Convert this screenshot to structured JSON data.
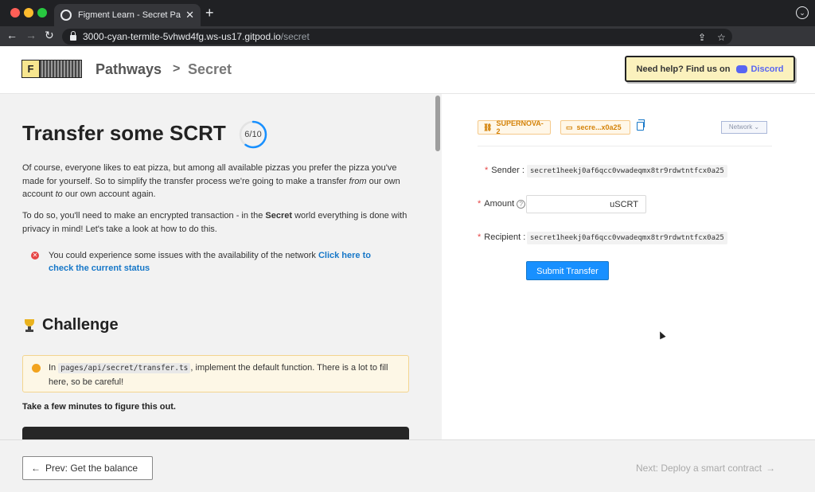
{
  "browser": {
    "tab_title": "Figment Learn - Secret Pathways",
    "url_host": "3000-cyan-termite-5vhwd4fg.ws-us17.gitpod.io",
    "url_path": "/secret"
  },
  "header": {
    "logo_letter": "F",
    "breadcrumb": [
      "Pathways",
      "Secret"
    ],
    "help_text": "Need help? Find us on",
    "discord_label": "Discord"
  },
  "left": {
    "title": "Transfer some SCRT",
    "progress": {
      "current": 6,
      "total": 10,
      "label": "6/10"
    },
    "para1": {
      "a": "Of course, everyone likes to eat pizza, but among all available pizzas you prefer the pizza you've made for yourself. So to simplify the transfer process we're going to make a transfer ",
      "em_from": "from",
      "b": " our own account ",
      "em_to": "to",
      "c": " our own account again."
    },
    "para2": {
      "a": "To do so, you'll need to make an encrypted transaction - in the ",
      "strong": "Secret",
      "b": " world everything is done with privacy in mind! Let's take a look at how to do this."
    },
    "alert": {
      "text": "You could experience some issues with the availability of the network ",
      "link": "Click here to check the current status"
    },
    "challenge_title": "Challenge",
    "warn": {
      "prefix": "In ",
      "code": "pages/api/secret/transfer.ts",
      "suffix": ", implement the default function. There is a lot to fill here, so be careful!"
    },
    "take_time": "Take a few minutes to figure this out."
  },
  "right": {
    "network_chip": "SUPERNOVA-2",
    "address_chip": "secre...x0a25",
    "network_select": "Network",
    "sender_label": "Sender",
    "sender_value": "secret1heekj0af6qcc0vwadeqmx8tr9rdwtntfcx0a25",
    "amount_label": "Amount",
    "amount_value": "",
    "amount_unit": "uSCRT",
    "recipient_label": "Recipient",
    "recipient_value": "secret1heekj0af6qcc0vwadeqmx8tr9rdwtntfcx0a25",
    "submit_label": "Submit Transfer"
  },
  "footer": {
    "prev_label": "Prev: Get the balance",
    "next_label": "Next: Deploy a smart contract"
  },
  "colors": {
    "accent": "#1890ff",
    "link": "#1677c8",
    "chip": "#d4830a",
    "error": "#e64545",
    "warning": "#f2a31d",
    "help_bg": "#fbf1bd"
  }
}
